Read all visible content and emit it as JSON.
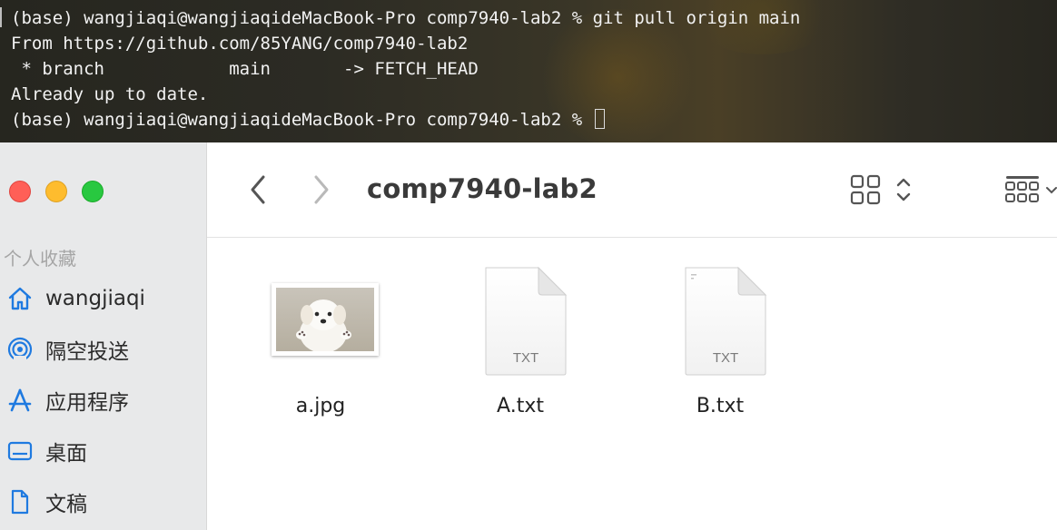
{
  "terminal": {
    "lines": [
      "(base) wangjiaqi@wangjiaqideMacBook-Pro comp7940-lab2 % git pull origin main",
      "From https://github.com/85YANG/comp7940-lab2",
      " * branch            main       -> FETCH_HEAD",
      "Already up to date.",
      "(base) wangjiaqi@wangjiaqideMacBook-Pro comp7940-lab2 % "
    ]
  },
  "finder": {
    "window_controls": [
      "close",
      "minimize",
      "zoom"
    ],
    "folder_title": "comp7940-lab2",
    "toolbar": {
      "back_icon": "chevron-left-icon",
      "forward_icon": "chevron-right-icon",
      "view_icon": "icon-grid-view-icon",
      "view_toggle_icon": "up-down-chevron-icon",
      "group_icon": "group-by-icon"
    },
    "sidebar": {
      "section_title": "个人收藏",
      "items": [
        {
          "label": "wangjiaqi",
          "icon": "home-icon"
        },
        {
          "label": "隔空投送",
          "icon": "airdrop-icon"
        },
        {
          "label": "应用程序",
          "icon": "applications-icon"
        },
        {
          "label": "桌面",
          "icon": "desktop-icon"
        },
        {
          "label": "文稿",
          "icon": "document-icon"
        }
      ]
    },
    "files": [
      {
        "name": "a.jpg",
        "kind": "image"
      },
      {
        "name": "A.txt",
        "kind": "text",
        "badge": "TXT"
      },
      {
        "name": "B.txt",
        "kind": "text",
        "badge": "TXT"
      }
    ],
    "colors": {
      "accent": "#1f7ae0",
      "close": "#ff5f57",
      "minimize": "#febc2e",
      "zoom": "#28c840"
    }
  }
}
